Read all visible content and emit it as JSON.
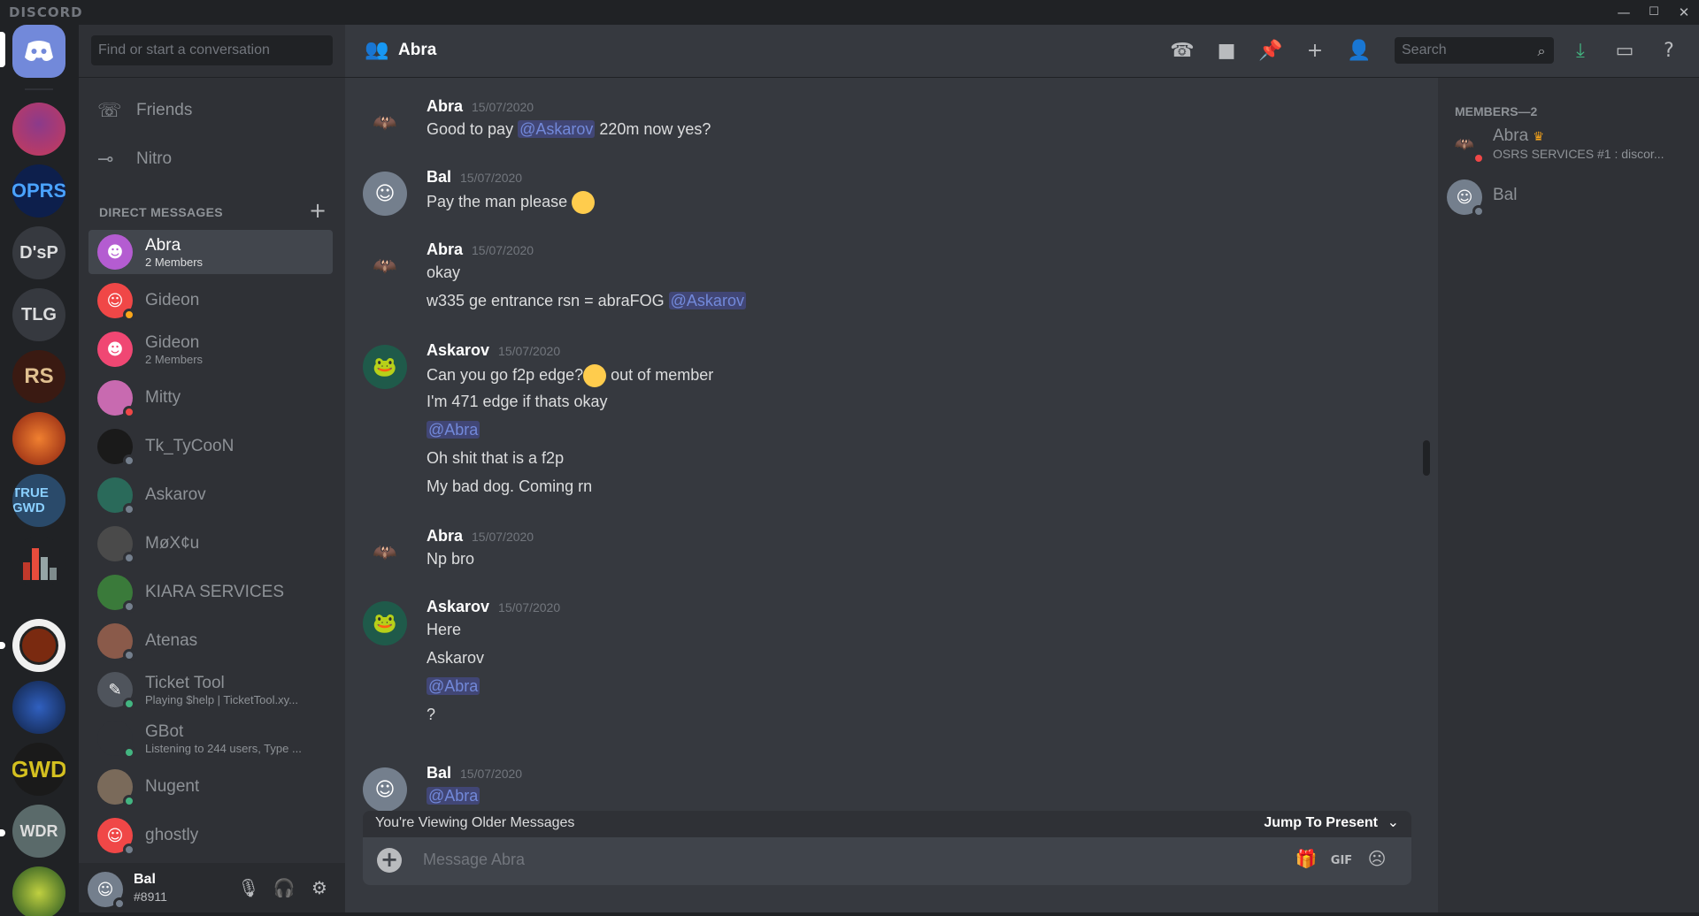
{
  "app": {
    "brand": "DISCORD"
  },
  "window_controls": {
    "minimize": "—",
    "maximize": "☐",
    "close": "✕"
  },
  "guilds": [
    "D'sP",
    "TLG"
  ],
  "dm": {
    "search_placeholder": "Find or start a conversation",
    "nav": [
      {
        "label": "Friends",
        "icon": "friends-icon"
      },
      {
        "label": "Nitro",
        "icon": "nitro-icon"
      }
    ],
    "header": "DIRECT MESSAGES",
    "items": [
      {
        "name": "Abra",
        "sub": "2 Members",
        "active": true
      },
      {
        "name": "Gideon",
        "sub": ""
      },
      {
        "name": "Gideon",
        "sub": "2 Members"
      },
      {
        "name": "Mitty",
        "sub": ""
      },
      {
        "name": "Tk_TyCooN",
        "sub": ""
      },
      {
        "name": "Askarov",
        "sub": ""
      },
      {
        "name": "MøX¢u",
        "sub": ""
      },
      {
        "name": "KIARA SERVICES",
        "sub": ""
      },
      {
        "name": "Atenas",
        "sub": ""
      },
      {
        "name": "Ticket Tool",
        "sub": "Playing $help | TicketTool.xy..."
      },
      {
        "name": "GBot",
        "sub": "Listening to 244 users, Type ..."
      },
      {
        "name": "Nugent",
        "sub": ""
      },
      {
        "name": "ghostly",
        "sub": ""
      }
    ]
  },
  "user": {
    "name": "Bal",
    "tag": "#8911"
  },
  "chat": {
    "title": "Abra",
    "search_placeholder": "Search",
    "messages": [
      {
        "author": "Abra",
        "time": "15/07/2020",
        "lines": [
          [
            "Good to pay ",
            "@Askarov",
            " 220m now yes?"
          ]
        ]
      },
      {
        "author": "Bal",
        "time": "15/07/2020",
        "lines": [
          [
            "Pay the man please",
            "",
            ""
          ]
        ]
      },
      {
        "author": "Abra",
        "time": "15/07/2020",
        "lines": [
          [
            "okay",
            "",
            ""
          ],
          [
            "w335 ge entrance rsn = abraFOG ",
            "@Askarov",
            ""
          ]
        ]
      },
      {
        "author": "Askarov",
        "time": "15/07/2020",
        "lines": [
          [
            "Can you go f2p edge?",
            "",
            " out of member"
          ],
          [
            "I'm 471 edge if thats okay",
            "",
            ""
          ],
          [
            "",
            "@Abra",
            ""
          ],
          [
            "Oh shit that is a f2p",
            "",
            ""
          ],
          [
            "My bad dog. Coming rn",
            "",
            ""
          ]
        ]
      },
      {
        "author": "Abra",
        "time": "15/07/2020",
        "lines": [
          [
            "Np bro",
            "",
            ""
          ]
        ]
      },
      {
        "author": "Askarov",
        "time": "15/07/2020",
        "lines": [
          [
            "Here",
            "",
            ""
          ],
          [
            "Askarov",
            "",
            ""
          ],
          [
            "",
            "@Abra",
            ""
          ],
          [
            "?",
            "",
            ""
          ]
        ]
      },
      {
        "author": "Bal",
        "time": "15/07/2020",
        "lines": [
          [
            "",
            "@Abra",
            ""
          ]
        ]
      }
    ],
    "older_notice": "You're Viewing Older Messages",
    "jump_label": "Jump To Present",
    "composer_placeholder": "Message Abra",
    "gif_label": "GIF"
  },
  "members": {
    "header": "MEMBERS—2",
    "list": [
      {
        "name": "Abra",
        "status": "OSRS SERVICES #1 : discor..."
      },
      {
        "name": "Bal",
        "status": ""
      }
    ]
  },
  "colors": {
    "accent": "#7289da",
    "online": "#43b581",
    "dnd": "#f04747",
    "idle": "#faa61a",
    "offline": "#747f8d"
  }
}
